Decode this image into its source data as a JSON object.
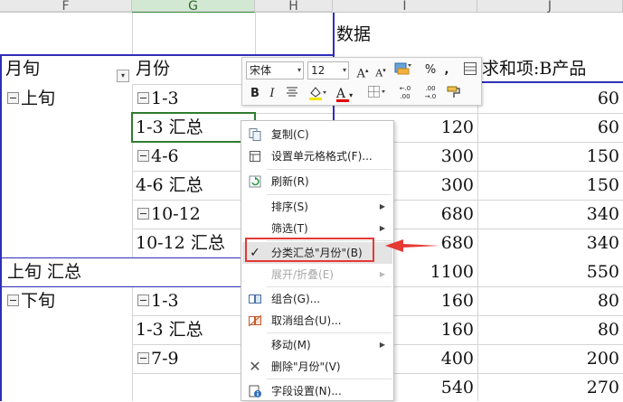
{
  "columns": [
    "F",
    "G",
    "H",
    "I",
    "J"
  ],
  "pivot": {
    "data_header": "数据",
    "row_field_1": "月旬",
    "row_field_2": "月份",
    "value_header_j": "求和项:B产品",
    "rows": [
      {
        "g": "1-3",
        "i": "",
        "j": "60"
      },
      {
        "g": "1-3 汇总",
        "i": "120",
        "j": "60"
      },
      {
        "g": "4-6",
        "i": "300",
        "j": "150"
      },
      {
        "g": "4-6 汇总",
        "i": "300",
        "j": "150"
      },
      {
        "g": "10-12",
        "i": "680",
        "j": "340"
      },
      {
        "g": "10-12 汇总",
        "i": "680",
        "j": "340"
      },
      {
        "f": "上旬 汇总",
        "i": "1100",
        "j": "550"
      },
      {
        "g": "1-3",
        "i": "160",
        "j": "80"
      },
      {
        "g": "1-3 汇总",
        "i": "160",
        "j": "80"
      },
      {
        "g": "7-9",
        "i": "400",
        "j": "200"
      },
      {
        "g": "",
        "i": "540",
        "j": "270"
      }
    ],
    "group_shangxun": "上旬",
    "group_xiaxun": "下旬"
  },
  "mini_toolbar": {
    "font_name": "宋体",
    "font_size": "12",
    "grow_font": "A",
    "shrink_font": "A",
    "percent": "%",
    "comma": ",",
    "bold": "B",
    "italic": "I",
    "font_color_letter": "A",
    "increase_decimal": "←.0 .00",
    "decrease_decimal": ".00 →.0"
  },
  "context_menu": {
    "items": [
      {
        "label": "复制(C)",
        "icon": "copy-icon"
      },
      {
        "label": "设置单元格格式(F)...",
        "icon": "format-cells-icon"
      },
      {
        "label": "刷新(R)",
        "icon": "refresh-icon"
      },
      {
        "label": "排序(S)",
        "icon": "",
        "submenu": true
      },
      {
        "label": "筛选(T)",
        "icon": "",
        "submenu": true
      },
      {
        "label": "分类汇总\"月份\"(B)",
        "icon": "checkmark-icon",
        "checked": true
      },
      {
        "label": "展开/折叠(E)",
        "icon": "",
        "submenu": true,
        "disabled": true
      },
      {
        "label": "组合(G)...",
        "icon": "group-icon"
      },
      {
        "label": "取消组合(U)...",
        "icon": "ungroup-icon"
      },
      {
        "label": "移动(M)",
        "icon": "",
        "submenu": true
      },
      {
        "label": "删除\"月份\"(V)",
        "icon": "delete-x-icon"
      },
      {
        "label": "字段设置(N)...",
        "icon": "field-settings-icon"
      }
    ]
  },
  "colors": {
    "pivot_border": "#2f2fb8",
    "highlight": "#e53935",
    "selected_column": "#3a8a3a"
  }
}
